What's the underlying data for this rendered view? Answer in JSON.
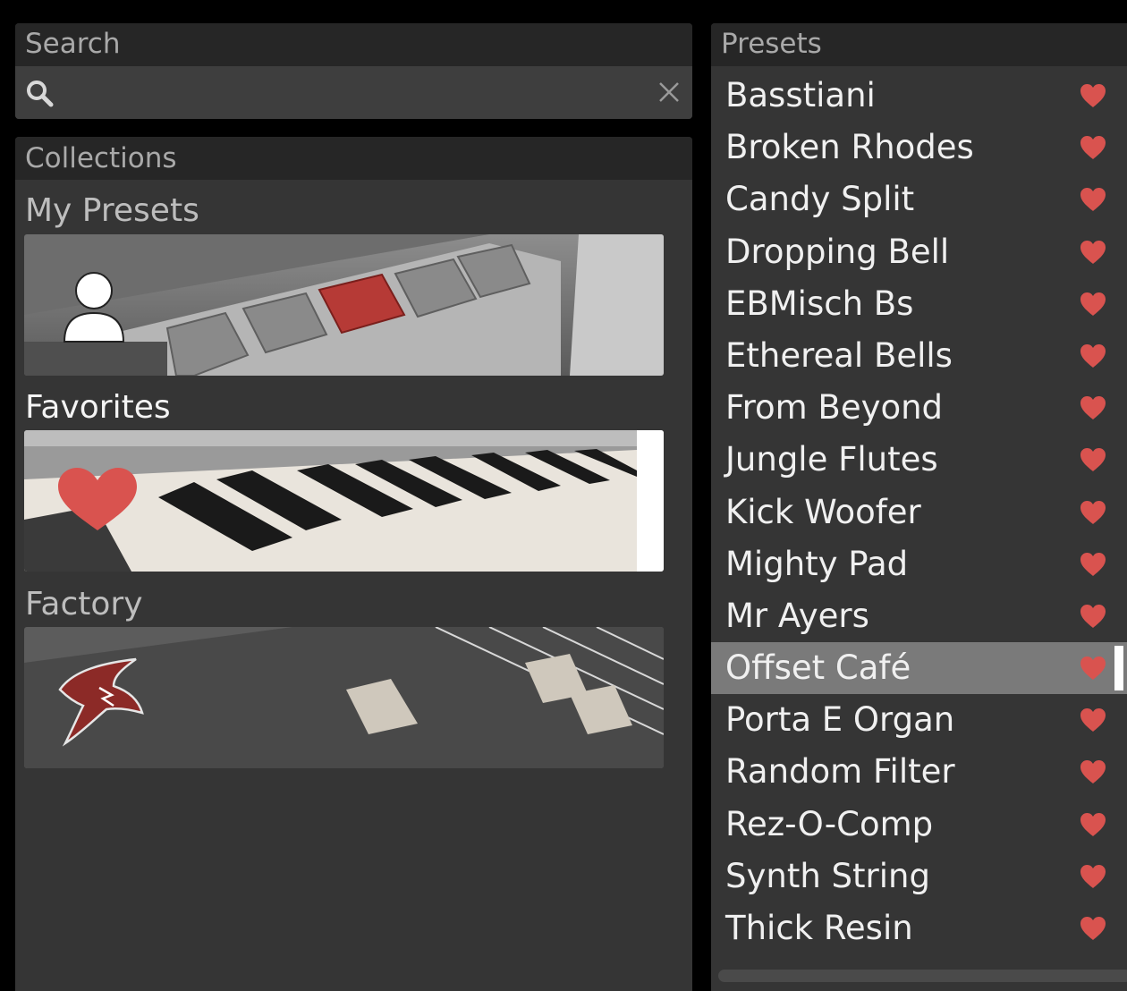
{
  "search": {
    "header": "Search",
    "value": "",
    "placeholder": ""
  },
  "collections": {
    "header": "Collections",
    "items": [
      {
        "label": "My Presets",
        "icon": "user-icon"
      },
      {
        "label": "Favorites",
        "icon": "heart-icon",
        "active": true
      },
      {
        "label": "Factory",
        "icon": "bird-logo-icon"
      }
    ]
  },
  "presets": {
    "header": "Presets",
    "items": [
      {
        "name": "Basstiani",
        "favorite": true
      },
      {
        "name": "Broken Rhodes",
        "favorite": true
      },
      {
        "name": "Candy Split",
        "favorite": true
      },
      {
        "name": "Dropping Bell",
        "favorite": true
      },
      {
        "name": "EBMisch Bs",
        "favorite": true
      },
      {
        "name": "Ethereal Bells",
        "favorite": true
      },
      {
        "name": "From Beyond",
        "favorite": true
      },
      {
        "name": "Jungle Flutes",
        "favorite": true
      },
      {
        "name": "Kick Woofer",
        "favorite": true
      },
      {
        "name": "Mighty Pad",
        "favorite": true
      },
      {
        "name": "Mr Ayers",
        "favorite": true
      },
      {
        "name": "Offset Café",
        "favorite": true,
        "selected": true
      },
      {
        "name": "Porta E Organ",
        "favorite": true
      },
      {
        "name": "Random Filter",
        "favorite": true
      },
      {
        "name": "Rez-O-Comp",
        "favorite": true
      },
      {
        "name": "Synth String",
        "favorite": true
      },
      {
        "name": "Thick Resin",
        "favorite": true
      }
    ]
  },
  "colors": {
    "heart": "#d9534f",
    "selected_row": "#7a7a7a",
    "panel_bg": "#353535",
    "header_bg": "#262626"
  }
}
